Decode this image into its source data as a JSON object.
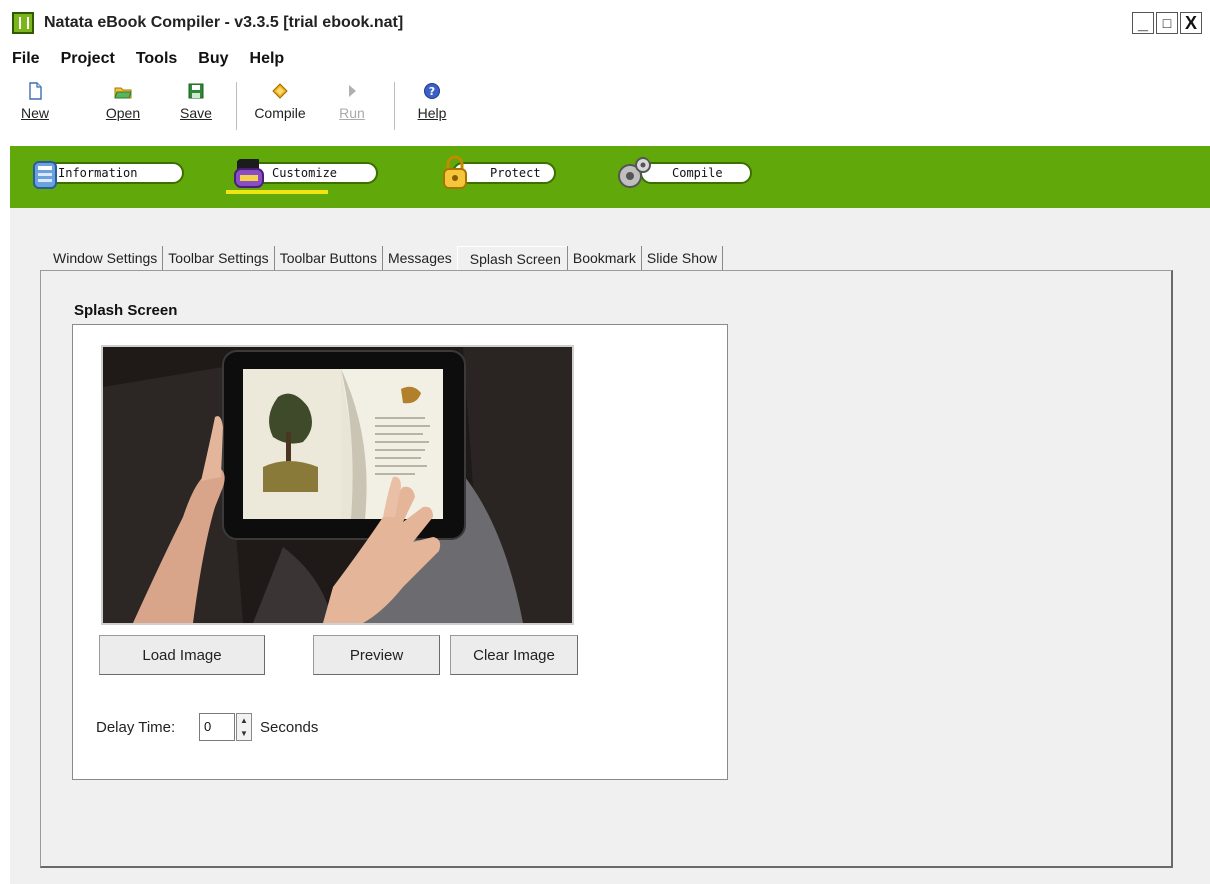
{
  "window": {
    "title": "Natata eBook Compiler - v3.3.5  [trial ebook.nat]",
    "minimize": "_",
    "maximize": "□",
    "close": "X"
  },
  "menu": [
    "File",
    "Project",
    "Tools",
    "Buy",
    "Help"
  ],
  "toolbar": {
    "new": {
      "label": "New",
      "icon": "new-document-icon"
    },
    "open": {
      "label": "Open",
      "icon": "open-folder-icon"
    },
    "save": {
      "label": "Save",
      "icon": "save-disk-icon"
    },
    "compile": {
      "label": "Compile",
      "icon": "compile-icon"
    },
    "run": {
      "label": "Run",
      "icon": "run-arrow-icon",
      "disabled": true
    },
    "help": {
      "label": "Help",
      "icon": "help-icon"
    }
  },
  "nav": {
    "color": "#61a80b",
    "tabs": [
      {
        "label": "Information",
        "icon": "information-icon"
      },
      {
        "label": "Customize",
        "icon": "customize-icon",
        "active": true
      },
      {
        "label": "Protect",
        "icon": "lock-icon"
      },
      {
        "label": "Compile",
        "icon": "gears-icon"
      }
    ]
  },
  "subtabs": [
    "Window Settings",
    "Toolbar Settings",
    "Toolbar Buttons",
    "Messages",
    "Splash Screen",
    "Bookmark",
    "Slide Show"
  ],
  "active_subtab": "Splash Screen",
  "splash": {
    "group_title": "Splash Screen",
    "image": "tablet-ebook-photo",
    "load_button": "Load Image",
    "preview_button": "Preview",
    "clear_button": "Clear Image",
    "delay_label": "Delay Time:",
    "delay_value": "0",
    "seconds_label": "Seconds"
  }
}
